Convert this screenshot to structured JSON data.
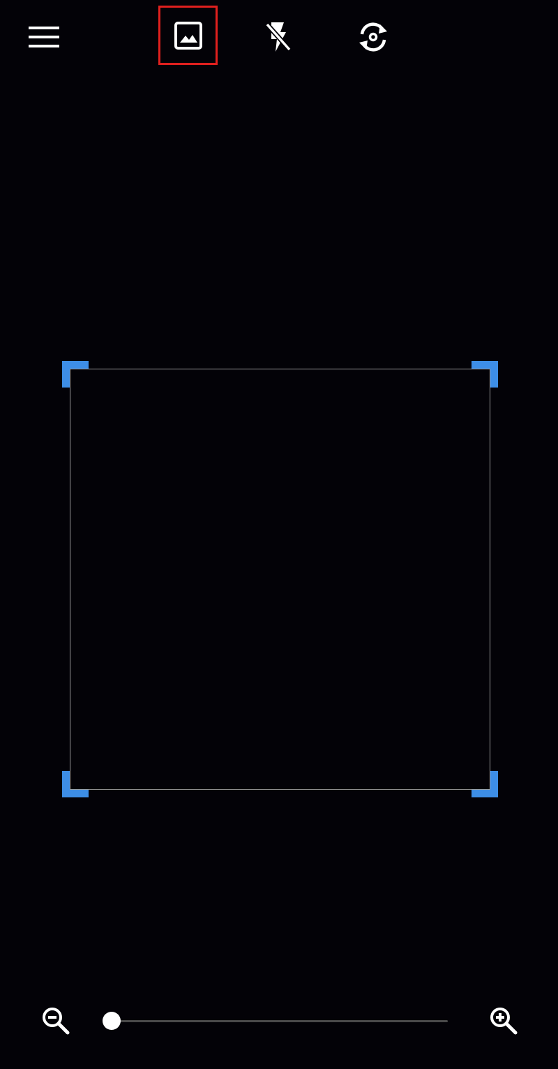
{
  "toolbar": {
    "menu_icon": "hamburger-menu-icon",
    "gallery_icon": "gallery-image-icon",
    "flash_icon": "flash-off-icon",
    "switch_icon": "switch-camera-icon",
    "gallery_highlighted": true,
    "highlight_color": "#e0201e"
  },
  "scanner": {
    "frame_border_color": "#9b9b9b",
    "corner_color": "#3d8ee6"
  },
  "zoom": {
    "zoom_out_icon": "zoom-out-icon",
    "zoom_in_icon": "zoom-in-icon",
    "level": 0.0
  },
  "colors": {
    "background": "#030207",
    "icon": "#ffffff"
  }
}
